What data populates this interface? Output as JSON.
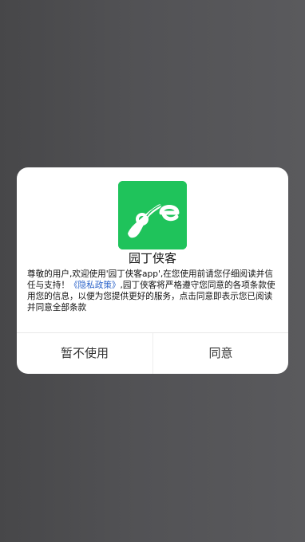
{
  "app": {
    "name": "园丁侠客",
    "icon": "leaf-e-logo-icon",
    "icon_color": "#1fc35b"
  },
  "privacy_dialog": {
    "text_before_link": "尊敬的用户,欢迎使用'园丁侠客app',在您使用前请您仔细阅读并信任与支持！",
    "policy_link": "《隐私政策》",
    "text_after_link": ",园丁侠客将严格遵守您同意的各项条款使用您的信息，以便为您提供更好的服务，点击同意即表示您已阅读并同意全部条款",
    "link_color": "#2a62c9"
  },
  "buttons": {
    "decline": "暂不使用",
    "agree": "同意"
  }
}
